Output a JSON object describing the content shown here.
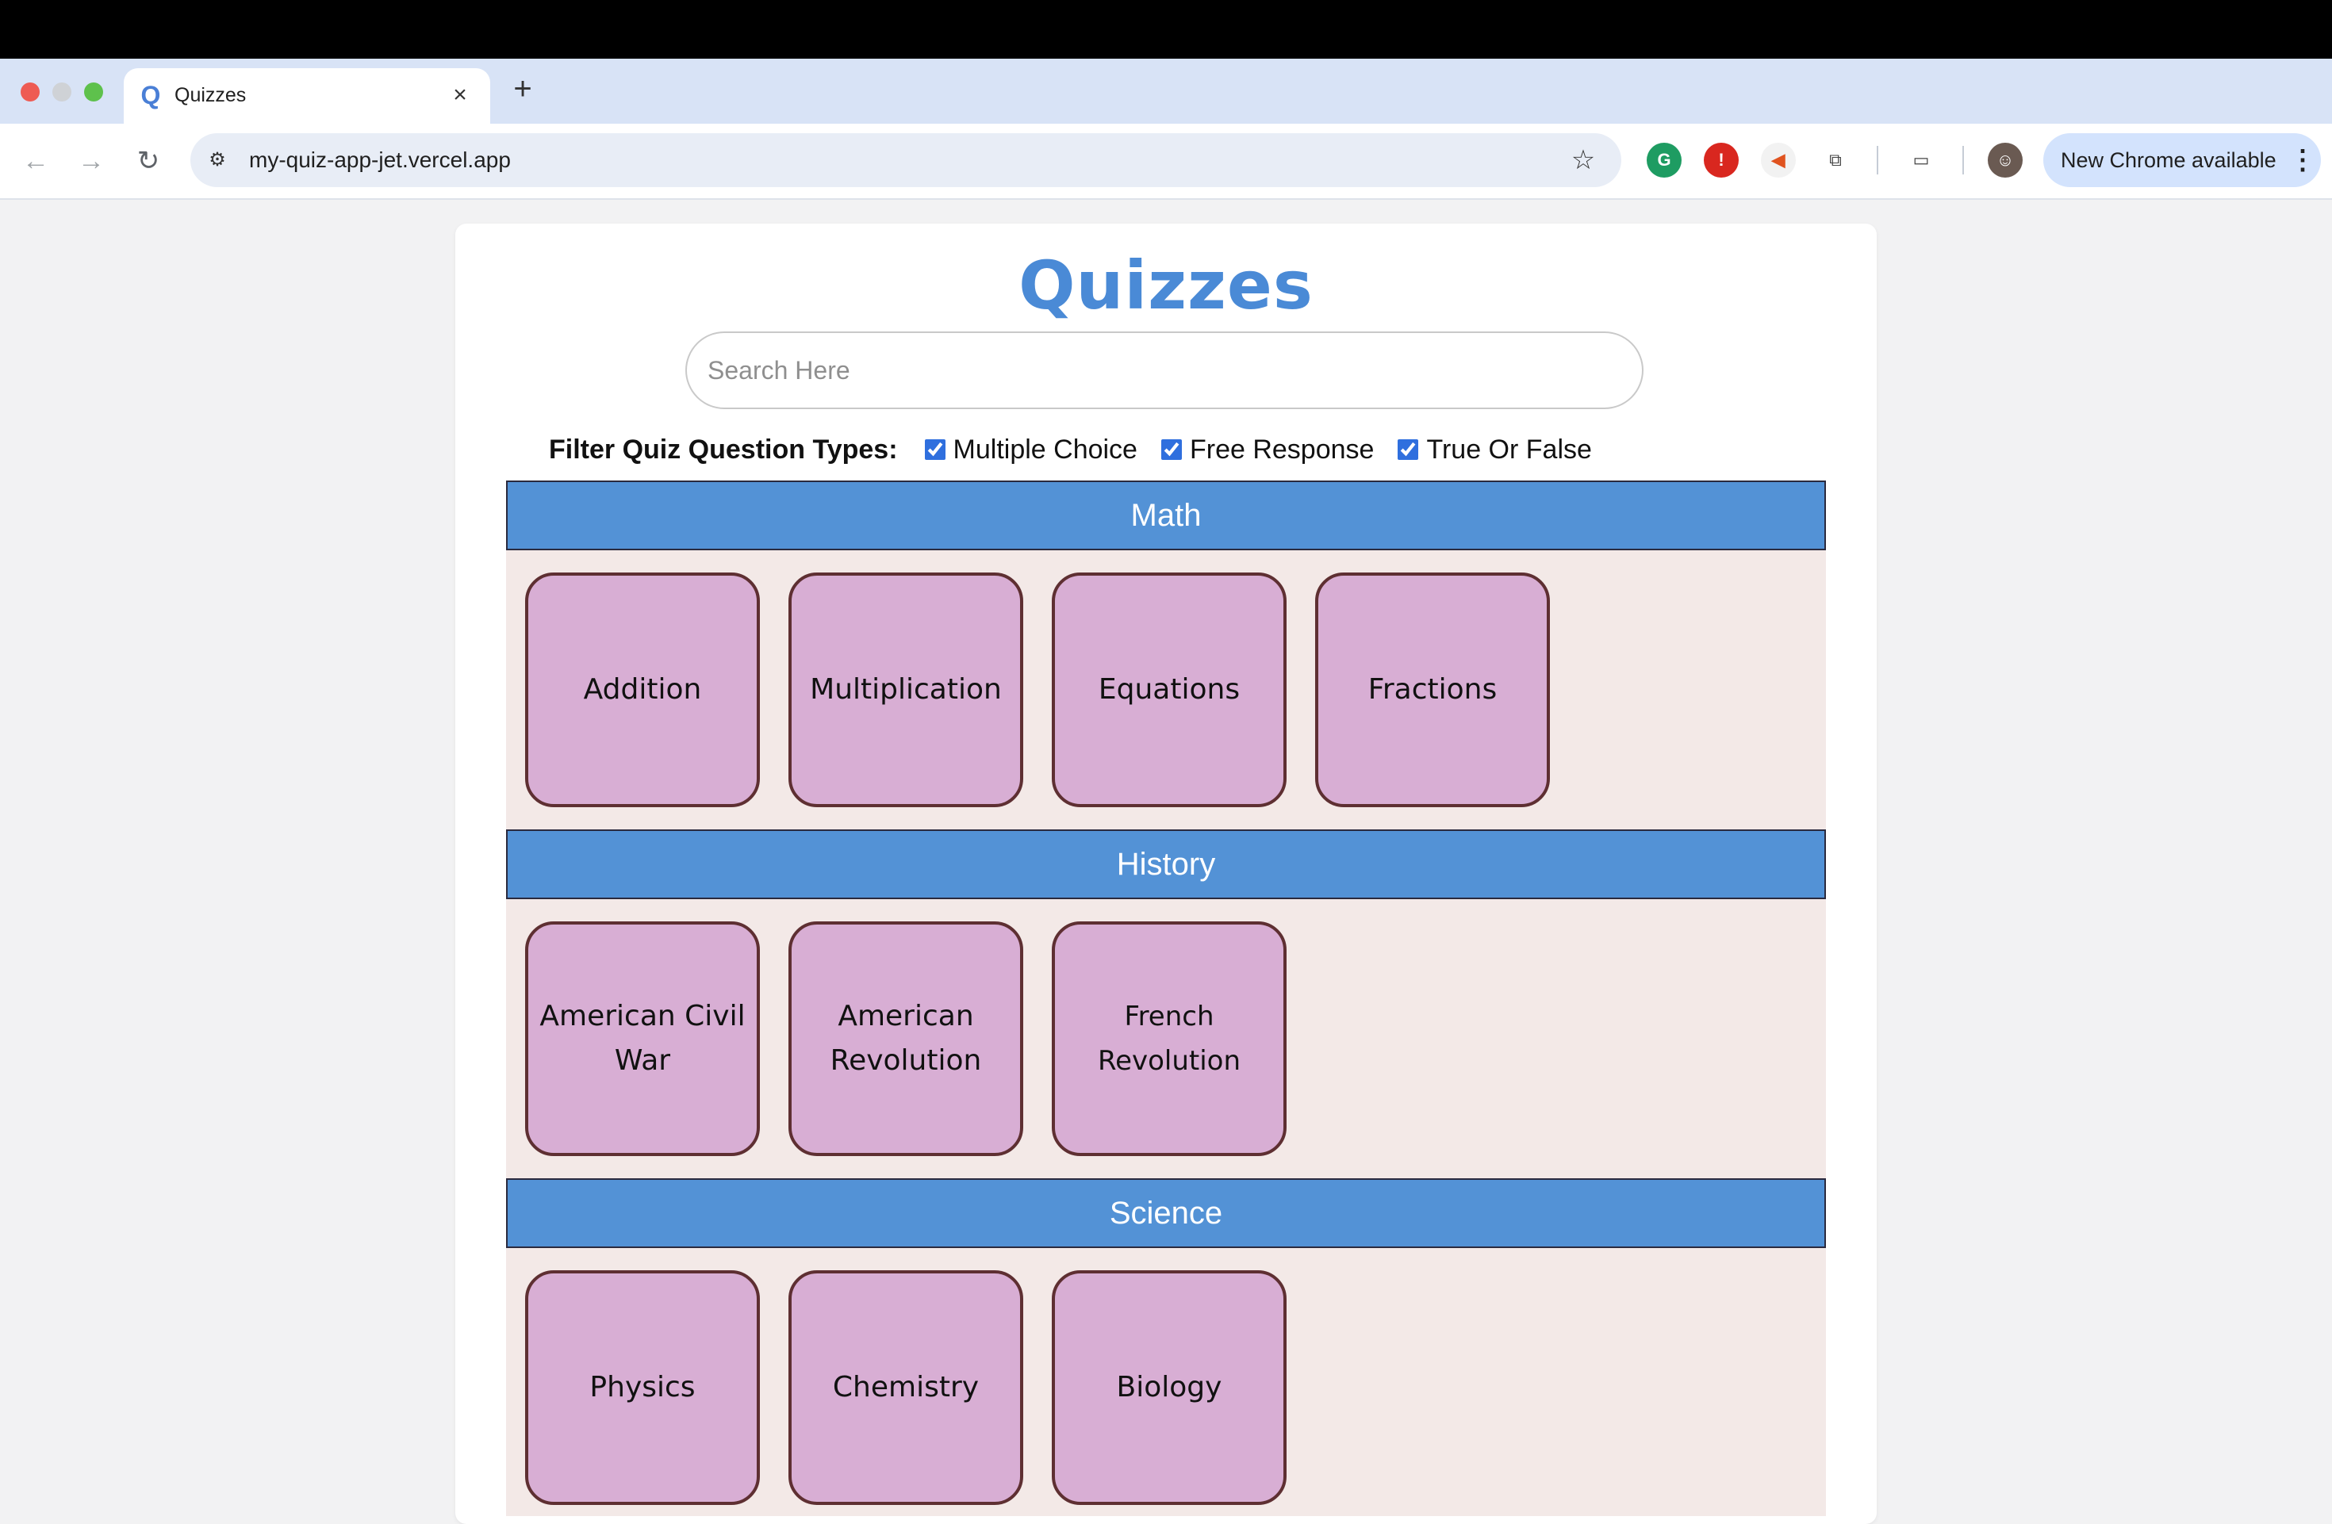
{
  "browser": {
    "tab_title": "Quizzes",
    "tab_favicon": "Q",
    "url": "my-quiz-app-jet.vercel.app",
    "update_button": "New Chrome available"
  },
  "page": {
    "title": "Quizzes",
    "search_placeholder": "Search Here",
    "filter": {
      "label": "Filter Quiz Question Types:",
      "options": [
        {
          "label": "Multiple Choice",
          "checked": true
        },
        {
          "label": "Free Response",
          "checked": true
        },
        {
          "label": "True Or False",
          "checked": true
        }
      ]
    },
    "categories": [
      {
        "name": "Math",
        "quizzes": [
          "Addition",
          "Multiplication",
          "Equations",
          "Fractions"
        ]
      },
      {
        "name": "History",
        "quizzes": [
          "American Civil War",
          "American Revolution",
          "French Revolution"
        ]
      },
      {
        "name": "Science",
        "quizzes": [
          "Physics",
          "Chemistry",
          "Biology"
        ]
      }
    ]
  },
  "colors": {
    "accent": "#5392d6",
    "title": "#4a8ad6",
    "tile": "#d8aed4",
    "tile_border": "#5e2f32",
    "section_bg": "#f3e9e7"
  }
}
